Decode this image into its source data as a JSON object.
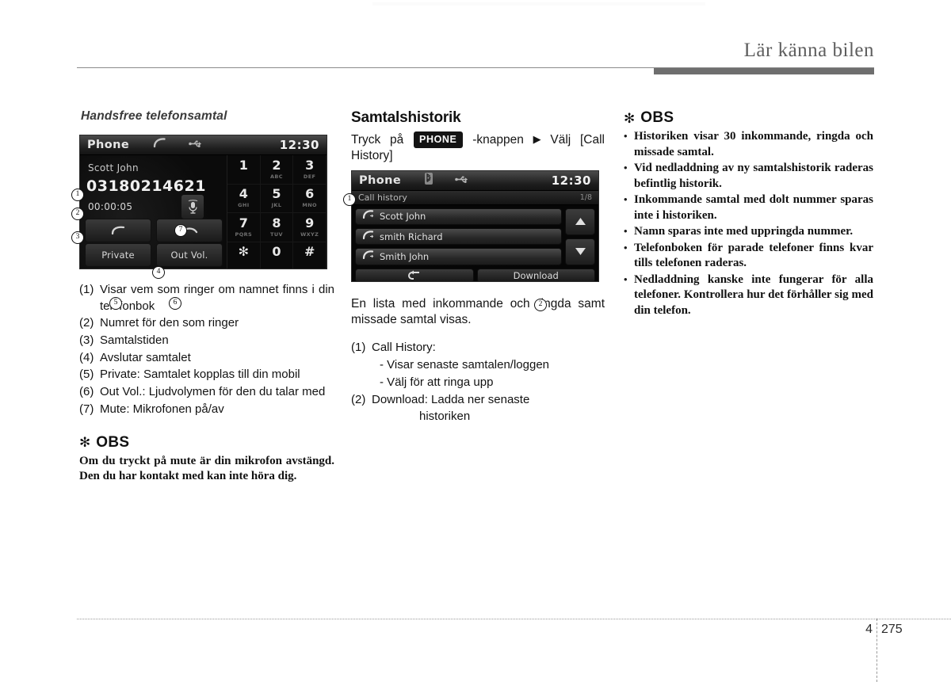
{
  "header": {
    "title": "Lär känna bilen"
  },
  "footer": {
    "chapter": "4",
    "page": "275"
  },
  "column_left": {
    "heading": "Handsfree telefonsamtal",
    "phone_screen": {
      "status_title": "Phone",
      "status_clock": "12:30",
      "call_icon": "call-handset-icon",
      "usb_icon": "usb-icon",
      "caller_name": "Scott John",
      "caller_number": "03180214621",
      "call_duration": "00:00:05",
      "mute_icon": "mute-microphone-icon",
      "answer_icon": "answer-call-icon",
      "end_icon": "end-call-icon",
      "private_label": "Private",
      "outvol_label": "Out Vol.",
      "keys": [
        {
          "digit": "1",
          "sub": ""
        },
        {
          "digit": "2",
          "sub": "ABC"
        },
        {
          "digit": "3",
          "sub": "DEF"
        },
        {
          "digit": "4",
          "sub": "GHI"
        },
        {
          "digit": "5",
          "sub": "JKL"
        },
        {
          "digit": "6",
          "sub": "MNO"
        },
        {
          "digit": "7",
          "sub": "PQRS"
        },
        {
          "digit": "8",
          "sub": "TUV"
        },
        {
          "digit": "9",
          "sub": "WXYZ"
        },
        {
          "digit": "✻",
          "sub": ""
        },
        {
          "digit": "0",
          "sub": ""
        },
        {
          "digit": "#",
          "sub": ""
        }
      ],
      "callouts": [
        "1",
        "2",
        "3",
        "4",
        "5",
        "6",
        "7"
      ]
    },
    "items": [
      {
        "n": "(1)",
        "text": "Visar vem som ringer om namnet finns i din telefonbok"
      },
      {
        "n": "(2)",
        "text": "Numret för den som ringer"
      },
      {
        "n": "(3)",
        "text": "Samtalstiden"
      },
      {
        "n": "(4)",
        "text": "Avslutar samtalet"
      },
      {
        "n": "(5)",
        "text": "Private: Samtalet kopplas till din mobil"
      },
      {
        "n": "(6)",
        "text": "Out Vol.: Ljudvolymen för den du talar med"
      },
      {
        "n": "(7)",
        "text": "Mute: Mikrofonen på/av"
      }
    ],
    "note": {
      "star": "✻",
      "word": "OBS",
      "body": "Om du tryckt på mute är din mikrofon avstängd. Den du har kontakt med kan inte höra dig."
    }
  },
  "column_middle": {
    "heading": "Samtalshistorik",
    "lead_before": "Tryck på",
    "key_chip": "PHONE",
    "lead_after": "-knappen",
    "arrow": "▶",
    "lead_end": "Välj [Call History]",
    "call_history_screen": {
      "status_title": "Phone",
      "status_clock": "12:30",
      "bluetooth_icon": "bluetooth-icon",
      "usb_icon": "usb-icon",
      "list_title": "Call history",
      "page_indicator": "1/8",
      "entries": [
        {
          "name": "Scott John",
          "icon": "incoming-call-icon"
        },
        {
          "name": "smith Richard",
          "icon": "outgoing-call-icon"
        },
        {
          "name": "Smith John",
          "icon": "outgoing-call-icon"
        }
      ],
      "scroll_up_icon": "arrow-up-icon",
      "scroll_down_icon": "arrow-down-icon",
      "back_icon": "back-arrow-icon",
      "download_label": "Download",
      "callouts": [
        "1",
        "2"
      ]
    },
    "caption": "En lista med inkommande och ringda samt missade samtal visas.",
    "items": [
      {
        "n": "(1)",
        "text": "Call History:"
      },
      {
        "n": "",
        "text": "- Visar senaste samtalen/loggen",
        "sub": true
      },
      {
        "n": "",
        "text": "- Välj för att ringa upp",
        "sub": true
      },
      {
        "n": "(2)",
        "text": "Download: Ladda ner senaste"
      },
      {
        "n": "",
        "text": "historiken",
        "indent": true
      }
    ]
  },
  "column_right": {
    "note": {
      "star": "✻",
      "word": "OBS",
      "bullets": [
        "Historiken visar 30 inkommande, ringda och missade samtal.",
        "Vid nedladdning av ny samtalshistorik raderas befintlig historik.",
        "Inkommande samtal med dolt nummer sparas inte i historiken.",
        "Namn sparas inte med uppringda nummer.",
        "Telefonboken för parade telefoner finns kvar tills telefonen raderas.",
        "Nedladdning kanske inte fungerar för alla telefoner. Kontrollera hur det förhåller sig med din telefon."
      ]
    }
  }
}
